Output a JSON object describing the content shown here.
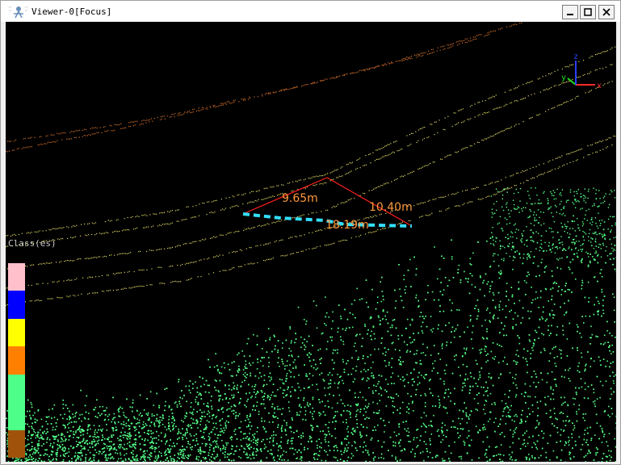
{
  "window": {
    "title": "Viewer-0[Focus]",
    "minimize_glyph": "▁",
    "maximize_glyph": "□",
    "close_glyph": "✕"
  },
  "viewport": {
    "background": "#000000"
  },
  "axes_gizmo": {
    "x_label": "x",
    "y_label": "y",
    "z_label": "z"
  },
  "measurements": [
    {
      "label": "9.65m"
    },
    {
      "label": "10.40m"
    },
    {
      "label": "18.19m"
    }
  ],
  "legend": {
    "title": "Class(es)",
    "colors": [
      "#ffc0cb",
      "#0000ff",
      "#ffff00",
      "#ff8000",
      "#4dff88",
      "#4dff88",
      "#a0520a"
    ]
  },
  "colors": {
    "wire": "#d8d060",
    "wire_far": "#c86a2a",
    "vegetation": "#55ff88",
    "measure_line": "#ff2020",
    "measure_dashed": "#33e0ff",
    "label": "#ff9a3c"
  }
}
